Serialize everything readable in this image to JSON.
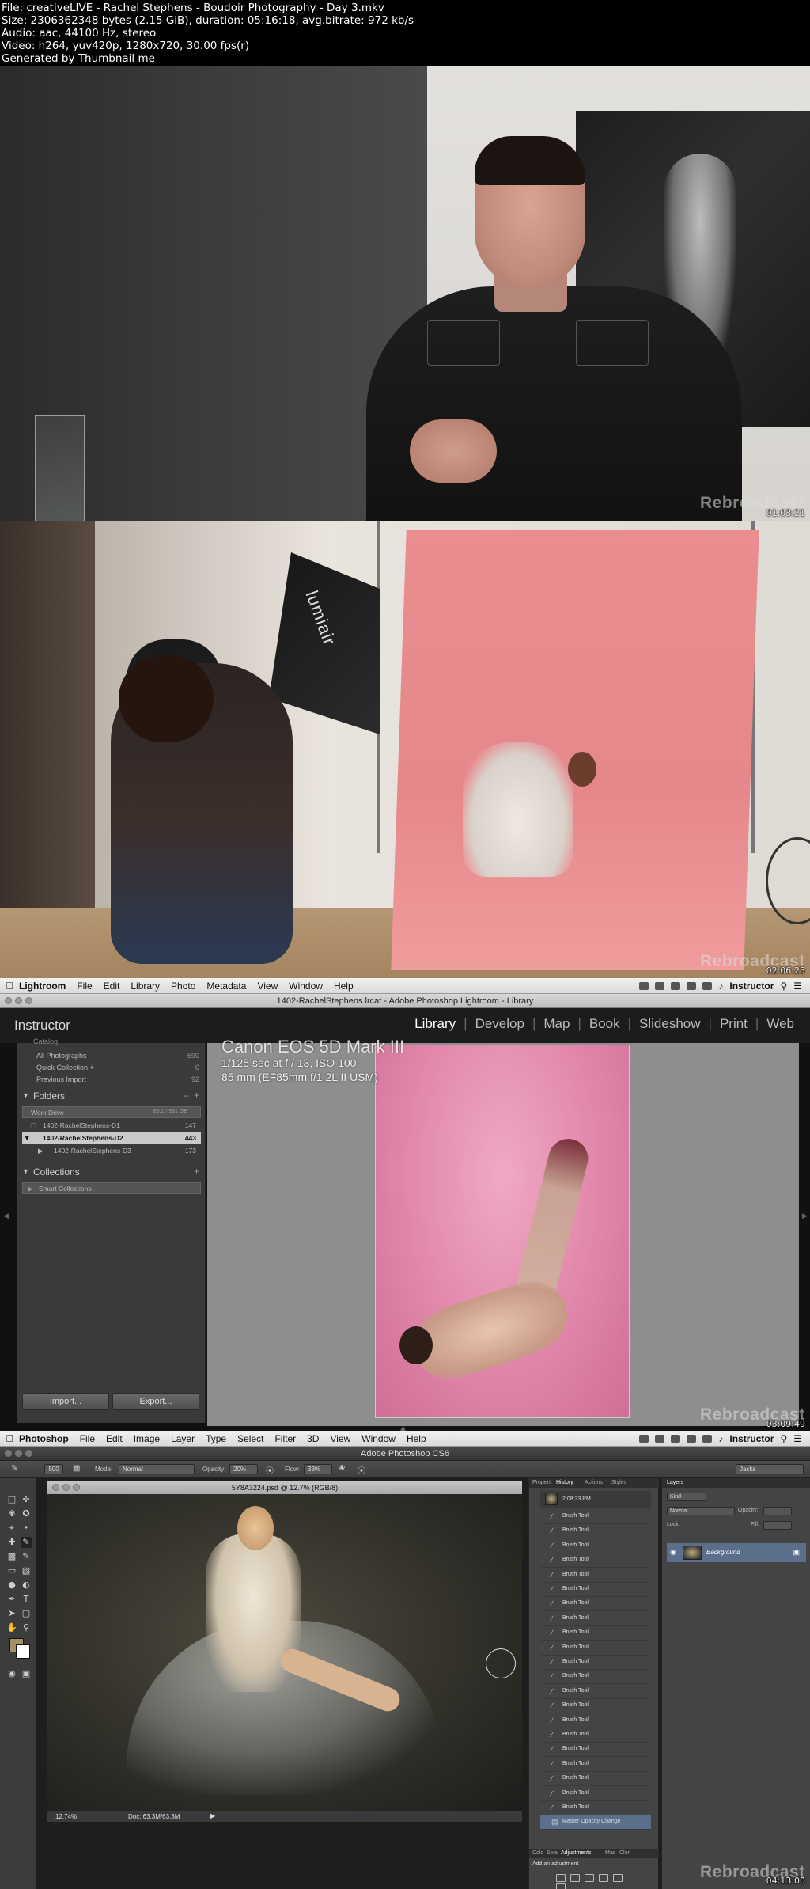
{
  "header": {
    "file": "File: creativeLIVE - Rachel Stephens - Boudoir Photography - Day 3.mkv",
    "size": "Size: 2306362348 bytes (2.15 GiB), duration: 05:16:18, avg.bitrate: 972 kb/s",
    "audio": "Audio: aac, 44100 Hz, stereo",
    "video": "Video: h264, yuv420p, 1280x720, 30.00 fps(r)",
    "generated": "Generated by Thumbnail me"
  },
  "frames": [
    {
      "timestamp": "01:03:21",
      "watermark": "Rebroadcast"
    },
    {
      "timestamp": "02:06:25",
      "watermark": "Rebroadcast",
      "softbox_brand": "lumiair"
    },
    {
      "timestamp": "03:09:49",
      "watermark": "Rebroadcast"
    },
    {
      "timestamp": "04:13:00",
      "watermark": "Rebroadcast"
    }
  ],
  "lightroom": {
    "menu": {
      "app": "Lightroom",
      "items": [
        "File",
        "Edit",
        "Library",
        "Photo",
        "Metadata",
        "View",
        "Window",
        "Help"
      ],
      "user": "Instructor"
    },
    "window_title": "1402-RachelStephens.lrcat - Adobe Photoshop Lightroom - Library",
    "identity_plate": "Instructor",
    "modules": [
      "Library",
      "Develop",
      "Map",
      "Book",
      "Slideshow",
      "Print",
      "Web"
    ],
    "active_module": "Library",
    "catalog": {
      "title": "Catalog",
      "rows": [
        {
          "label": "All Photographs",
          "count": "590"
        },
        {
          "label": "Quick Collection +",
          "count": "0"
        },
        {
          "label": "Previous Import",
          "count": "92"
        }
      ]
    },
    "folders": {
      "title": "Folders",
      "drive": {
        "label": "Work Drive",
        "info": "83.1 / 931 GB"
      },
      "items": [
        {
          "label": "1402-RachelStephens-D1",
          "count": "147"
        },
        {
          "label": "1402-RachelStephens-D2",
          "count": "443"
        },
        {
          "label": "1402-RachelStephens-D3",
          "count": "173"
        }
      ]
    },
    "collections": {
      "title": "Collections",
      "items": [
        "Smart Collections"
      ]
    },
    "buttons": {
      "import": "Import...",
      "export": "Export..."
    },
    "photo_info": {
      "camera": "Canon EOS 5D Mark III",
      "exposure": "1/125 sec at f / 13, ISO 100",
      "lens": "85 mm (EF85mm f/1.2L II USM)"
    }
  },
  "photoshop": {
    "menu": {
      "app": "Photoshop",
      "items": [
        "File",
        "Edit",
        "Image",
        "Layer",
        "Type",
        "Select",
        "Filter",
        "3D",
        "View",
        "Window",
        "Help"
      ],
      "user": "Instructor"
    },
    "window_title": "Adobe Photoshop CS6",
    "options": {
      "brush_size": "500",
      "mode_label": "Mode:",
      "mode_value": "Normal",
      "opacity_label": "Opacity:",
      "opacity_value": "20%",
      "flow_label": "Flow:",
      "flow_value": "33%",
      "workspace": "Jacks"
    },
    "document_tab": "5Y8A3224.psd @ 12.7% (RGB/8)",
    "status": {
      "zoom": "12.74%",
      "doc": "Doc: 63.3M/63.3M"
    },
    "history": {
      "tabs": [
        "Properti",
        "History",
        "Actions",
        "Styles"
      ],
      "snapshot_time": "2:08:33 PM",
      "items": [
        "Brush Tool",
        "Brush Tool",
        "Brush Tool",
        "Brush Tool",
        "Brush Tool",
        "Brush Tool",
        "Brush Tool",
        "Brush Tool",
        "Brush Tool",
        "Brush Tool",
        "Brush Tool",
        "Brush Tool",
        "Brush Tool",
        "Brush Tool",
        "Brush Tool",
        "Brush Tool",
        "Brush Tool",
        "Brush Tool",
        "Brush Tool",
        "Brush Tool",
        "Brush Tool"
      ],
      "last_item": "Master Opacity Change"
    },
    "adjustments": {
      "tabs": [
        "Colo",
        "Swa",
        "Adjustments",
        "Mas",
        "Clon"
      ],
      "title": "Add an adjustment"
    },
    "layers": {
      "tab": "Layers",
      "kind": "Kind",
      "blend": "Normal",
      "opacity_label": "Opacity:",
      "lock_label": "Lock:",
      "fill_label": "Fill:",
      "layer_name": "Background"
    }
  }
}
